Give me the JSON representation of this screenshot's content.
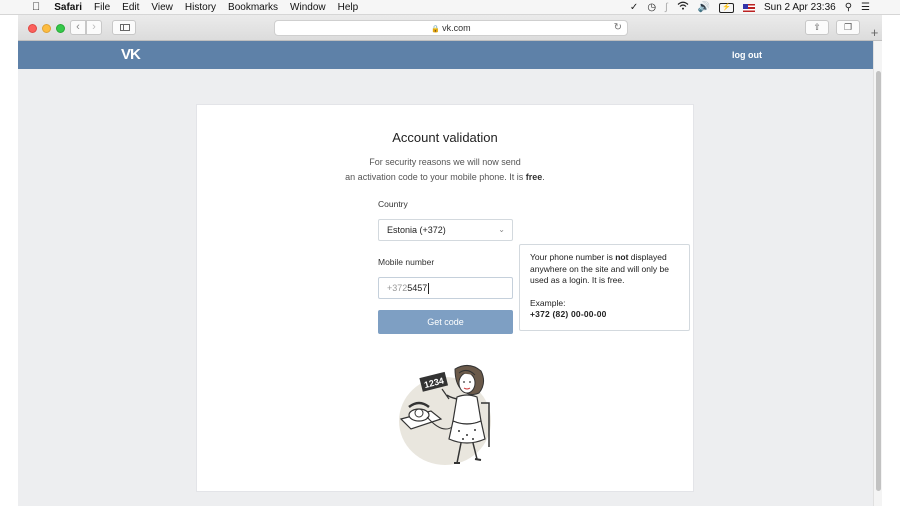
{
  "menubar": {
    "apple": "",
    "app": "Safari",
    "items": [
      "File",
      "Edit",
      "View",
      "History",
      "Bookmarks",
      "Window",
      "Help"
    ],
    "clock": "Sun 2 Apr  23:36",
    "battery_label": "⚡"
  },
  "browser": {
    "url": "vk.com",
    "icons": [
      "back-icon",
      "forward-icon",
      "sidebar-icon",
      "lock-icon",
      "reload-icon",
      "share-icon",
      "tabs-icon",
      "new-tab-icon"
    ]
  },
  "header": {
    "logo_text": "VK",
    "logout_label": "log out",
    "color": "#5e81a8"
  },
  "form": {
    "title": "Account validation",
    "sub_line1": "For security reasons we will now send",
    "sub_line2_a": "an activation code to your mobile phone. It is ",
    "sub_line2_b": "free",
    "sub_line2_c": ".",
    "country_label": "Country",
    "country_value": "Estonia (+372)",
    "mobile_label": "Mobile number",
    "mobile_prefix": "+372",
    "mobile_value": "5457",
    "button_label": "Get code",
    "button_color": "#7e9fc3"
  },
  "tooltip": {
    "t1": "Your phone number is ",
    "t_bold": "not",
    "t2": " displayed anywhere on the site and will only be used as a login. It is free.",
    "example_label": "Example:",
    "example_number": "+372 (82) 00-00-00"
  },
  "illustration": {
    "sign_text": "1234"
  }
}
